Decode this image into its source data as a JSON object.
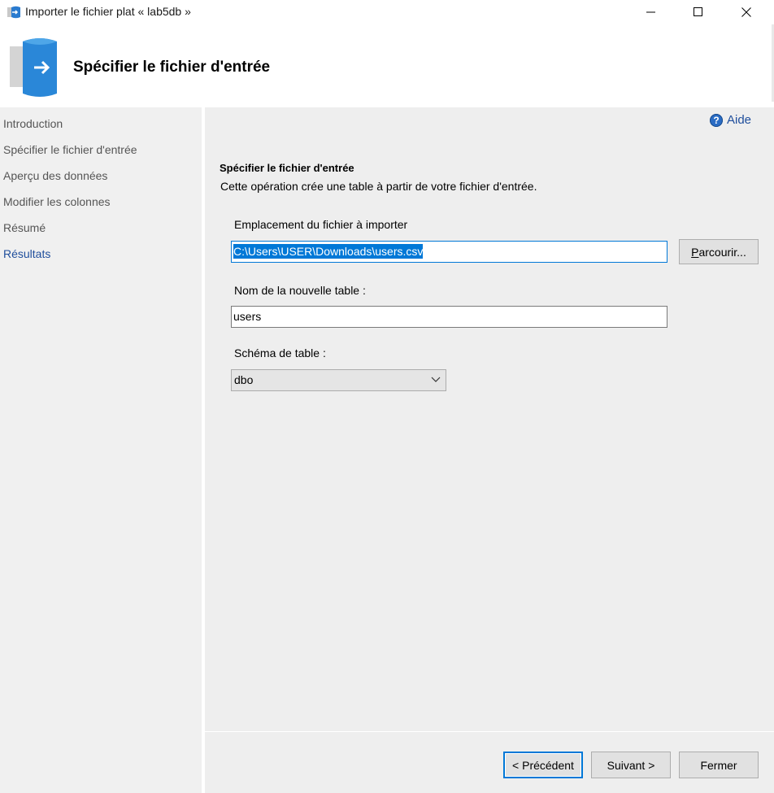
{
  "window": {
    "title": "Importer le fichier plat « lab5db »"
  },
  "header": {
    "title": "Spécifier le fichier d'entrée",
    "icon": "import-database-icon"
  },
  "nav": {
    "items": [
      {
        "label": "Introduction",
        "active": false
      },
      {
        "label": "Spécifier le fichier d'entrée",
        "active": false
      },
      {
        "label": "Aperçu des données",
        "active": false
      },
      {
        "label": "Modifier les colonnes",
        "active": false
      },
      {
        "label": "Résumé",
        "active": false
      },
      {
        "label": "Résultats",
        "active": true
      }
    ]
  },
  "help": {
    "label": "Aide",
    "glyph": "?"
  },
  "section": {
    "title": "Spécifier le fichier d'entrée",
    "description": "Cette opération crée une table à partir de votre fichier d'entrée."
  },
  "file_location": {
    "label": "Emplacement du fichier à importer",
    "value": "C:\\Users\\USER\\Downloads\\users.csv",
    "browse_prefix": "P",
    "browse_rest": "arcourir..."
  },
  "table_name": {
    "label": "Nom de la nouvelle table :",
    "value": "users"
  },
  "schema": {
    "label": "Schéma de table :",
    "selected": "dbo"
  },
  "buttons": {
    "previous": "< Précédent",
    "next": "Suivant >",
    "close": "Fermer"
  },
  "colors": {
    "accent": "#0078d7",
    "link": "#1f4e9c"
  }
}
